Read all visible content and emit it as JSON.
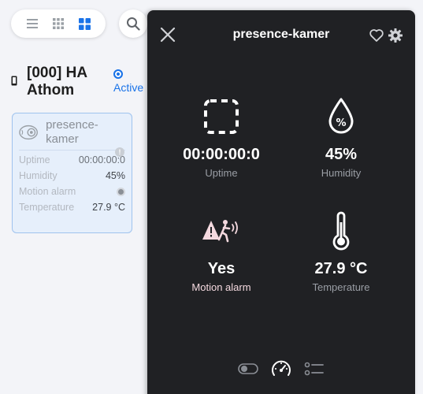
{
  "view_switch": {
    "icons": [
      "list-icon",
      "grid-small-icon",
      "grid-large-icon"
    ],
    "active": "grid-large-icon",
    "accent": "#1a73e8"
  },
  "search": {
    "icon": "search-icon"
  },
  "device": {
    "title": "[000] HA Athom",
    "status_label": "Active",
    "card": {
      "name": "presence-kamer",
      "warning_icon": "!",
      "rows": [
        {
          "label": "Uptime",
          "value": "00:00:00:0"
        },
        {
          "label": "Humidity",
          "value": "45%"
        },
        {
          "label": "Motion alarm",
          "value": ""
        },
        {
          "label": "Temperature",
          "value": "27.9 °C"
        }
      ]
    }
  },
  "panel": {
    "title": "presence-kamer",
    "background": "#202124",
    "tiles": [
      {
        "icon": "uptime-icon",
        "value": "00:00:00:0",
        "label": "Uptime"
      },
      {
        "icon": "humidity-icon",
        "value": "45%",
        "label": "Humidity"
      },
      {
        "icon": "motion-alarm-icon",
        "value": "Yes",
        "label": "Motion alarm"
      },
      {
        "icon": "thermometer-icon",
        "value": "27.9 °C",
        "label": "Temperature"
      }
    ],
    "bottom_icons": [
      "toggle-icon",
      "gauge-icon",
      "list-settings-icon"
    ],
    "alarm_color": "#f4d9df"
  }
}
